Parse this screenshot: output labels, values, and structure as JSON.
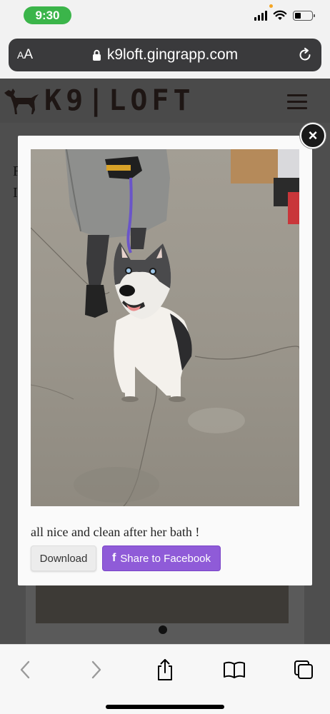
{
  "status_bar": {
    "time": "9:30",
    "time_pill_color": "#3bb54a",
    "icons": [
      "signal-icon",
      "wifi-icon",
      "battery-icon"
    ],
    "battery_level": 0.35
  },
  "browser": {
    "text_size_label_small": "A",
    "text_size_label_large": "A",
    "url": "k9loft.gingrapp.com",
    "icons": [
      "lock-icon",
      "reload-icon"
    ]
  },
  "site": {
    "logo_text": "K9|LOFT",
    "menu_icon": "hamburger-icon",
    "background_letters": [
      "F",
      "I"
    ]
  },
  "modal": {
    "image_alt": "Husky dog sitting on concrete floor next to a groomer",
    "caption": "all nice and clean after her bath !",
    "download_label": "Download",
    "share_label": "Share to Facebook",
    "share_color": "#8f5bd8",
    "close_icon": "close-icon"
  },
  "toolbar": {
    "icons": [
      "back-icon",
      "forward-icon",
      "share-icon",
      "bookmarks-icon",
      "tabs-icon"
    ]
  }
}
